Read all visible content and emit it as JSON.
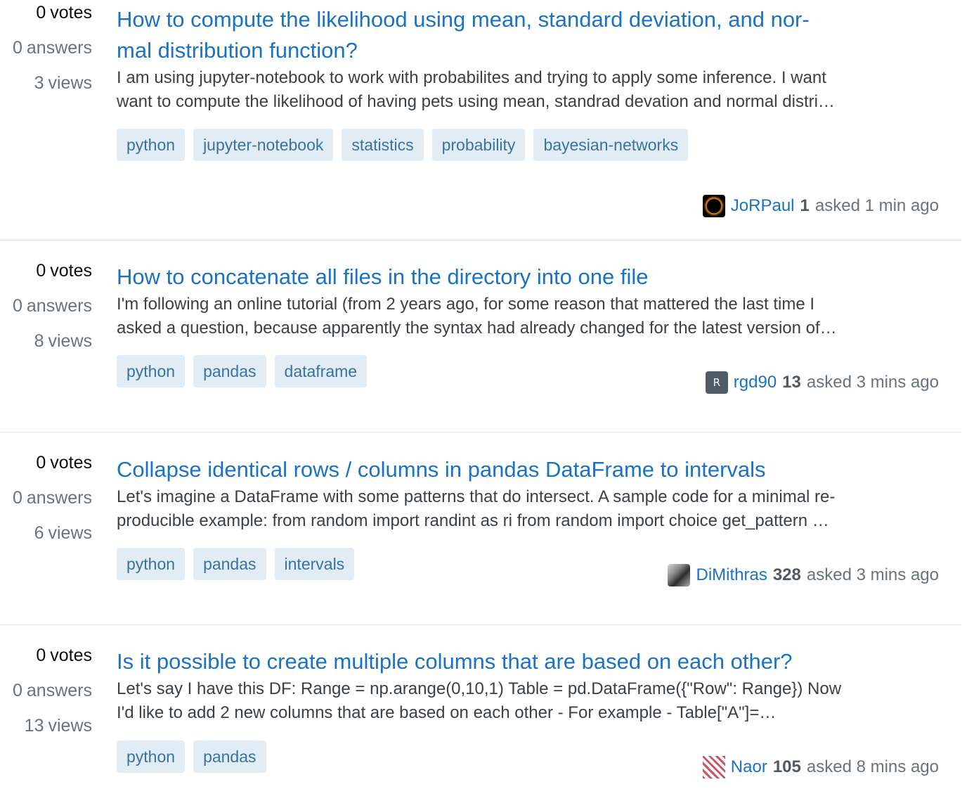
{
  "stats_labels": {
    "votes": "votes",
    "answers": "answers",
    "views": "views"
  },
  "asked_label": "asked",
  "questions": [
    {
      "votes": "0",
      "answers": "0",
      "views": "3",
      "title_lines": [
        "How to compute the likelihood using mean, standard deviation, and nor-",
        "mal distribution function?"
      ],
      "excerpt_lines": [
        "I am using jupyter-notebook to work with probabilites and trying to apply some inference. I want",
        "want to compute the likelihood of having pets using mean, standrad devation and normal distri…"
      ],
      "tags": [
        "python",
        "jupyter-notebook",
        "statistics",
        "probability",
        "bayesian-networks"
      ],
      "user": {
        "name": "JoRPaul",
        "rep": "1",
        "avatar": "avatar-image",
        "avatar_letter": ""
      },
      "time": "1 min ago"
    },
    {
      "votes": "0",
      "answers": "0",
      "views": "8",
      "title_lines": [
        "How to concatenate all files in the directory into one file"
      ],
      "excerpt_lines": [
        "I'm following an online tutorial (from 2 years ago, for some reason that mattered the last time I",
        "asked a question, because apparently the syntax had already changed for the latest version of…"
      ],
      "tags": [
        "python",
        "pandas",
        "dataframe"
      ],
      "user": {
        "name": "rgd90",
        "rep": "13",
        "avatar": "letter-avatar",
        "avatar_letter": "R"
      },
      "time": "3 mins ago"
    },
    {
      "votes": "0",
      "answers": "0",
      "views": "6",
      "title_lines": [
        "Collapse identical rows / columns in pandas DataFrame to intervals"
      ],
      "excerpt_lines": [
        "Let's imagine a DataFrame with some patterns that do intersect. A sample code for a minimal re-",
        "producible example: from random import randint as ri from random import choice get_pattern …"
      ],
      "tags": [
        "python",
        "pandas",
        "intervals"
      ],
      "user": {
        "name": "DiMithras",
        "rep": "328",
        "avatar": "avatar-image",
        "avatar_letter": ""
      },
      "time": "3 mins ago"
    },
    {
      "votes": "0",
      "answers": "0",
      "views": "13",
      "title_lines": [
        "Is it possible to create multiple columns that are based on each other?"
      ],
      "excerpt_lines": [
        "Let's say I have this DF: Range = np.arange(0,10,1) Table = pd.DataFrame({\"Row\": Range}) Now",
        "I'd like to add 2 new columns that are based on each other - For example - Table[\"A\"]=…"
      ],
      "tags": [
        "python",
        "pandas"
      ],
      "user": {
        "name": "Naor",
        "rep": "105",
        "avatar": "identicon-avatar",
        "avatar_letter": ""
      },
      "time": "8 mins ago"
    }
  ]
}
